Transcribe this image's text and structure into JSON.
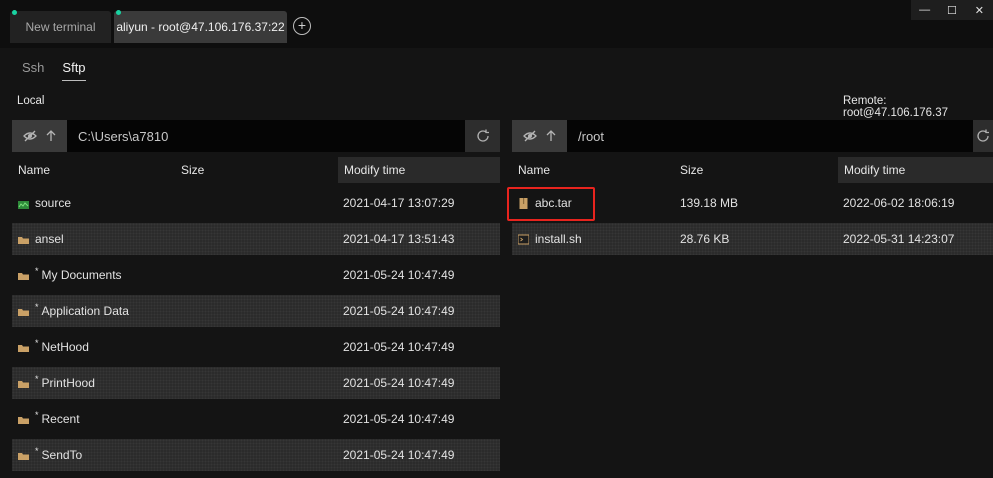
{
  "tabs": [
    {
      "label": "New terminal",
      "active": false,
      "dot_color": "#19d3a2"
    },
    {
      "label": "aliyun - root@47.106.176.37:22",
      "active": true,
      "dot_color": "#19d3a2"
    }
  ],
  "add_tab_glyph": "+",
  "window_controls": {
    "minimize": "—",
    "maximize": "☐",
    "close": "✕"
  },
  "subtabs": [
    {
      "label": "Ssh",
      "active": false
    },
    {
      "label": "Sftp",
      "active": true
    }
  ],
  "local": {
    "label": "Local",
    "path": "C:\\Users\\a7810",
    "columns": {
      "name": "Name",
      "size": "Size",
      "modify_time": "Modify time"
    },
    "files": [
      {
        "name": "source",
        "size": "",
        "time": "2021-04-17 13:07:29",
        "icon": "git-folder-icon",
        "star": false
      },
      {
        "name": "ansel",
        "size": "",
        "time": "2021-04-17 13:51:43",
        "icon": "folder-icon",
        "star": false
      },
      {
        "name": "My Documents",
        "size": "",
        "time": "2021-05-24 10:47:49",
        "icon": "folder-icon",
        "star": true
      },
      {
        "name": "Application Data",
        "size": "",
        "time": "2021-05-24 10:47:49",
        "icon": "folder-icon",
        "star": true
      },
      {
        "name": "NetHood",
        "size": "",
        "time": "2021-05-24 10:47:49",
        "icon": "folder-icon",
        "star": true
      },
      {
        "name": "PrintHood",
        "size": "",
        "time": "2021-05-24 10:47:49",
        "icon": "folder-icon",
        "star": true
      },
      {
        "name": "Recent",
        "size": "",
        "time": "2021-05-24 10:47:49",
        "icon": "folder-icon",
        "star": true
      },
      {
        "name": "SendTo",
        "size": "",
        "time": "2021-05-24 10:47:49",
        "icon": "folder-icon",
        "star": true
      }
    ]
  },
  "remote": {
    "label": "Remote: root@47.106.176.37",
    "path": "/root",
    "columns": {
      "name": "Name",
      "size": "Size",
      "modify_time": "Modify time"
    },
    "files": [
      {
        "name": "abc.tar",
        "size": "139.18 MB",
        "time": "2022-06-02 18:06:19",
        "icon": "archive-icon",
        "star": false
      },
      {
        "name": "install.sh",
        "size": "28.76 KB",
        "time": "2022-05-31 14:23:07",
        "icon": "script-icon",
        "star": false
      }
    ]
  },
  "colors": {
    "highlight": "#e8241e",
    "folder": "#c9a066",
    "accent": "#19d3a2"
  }
}
